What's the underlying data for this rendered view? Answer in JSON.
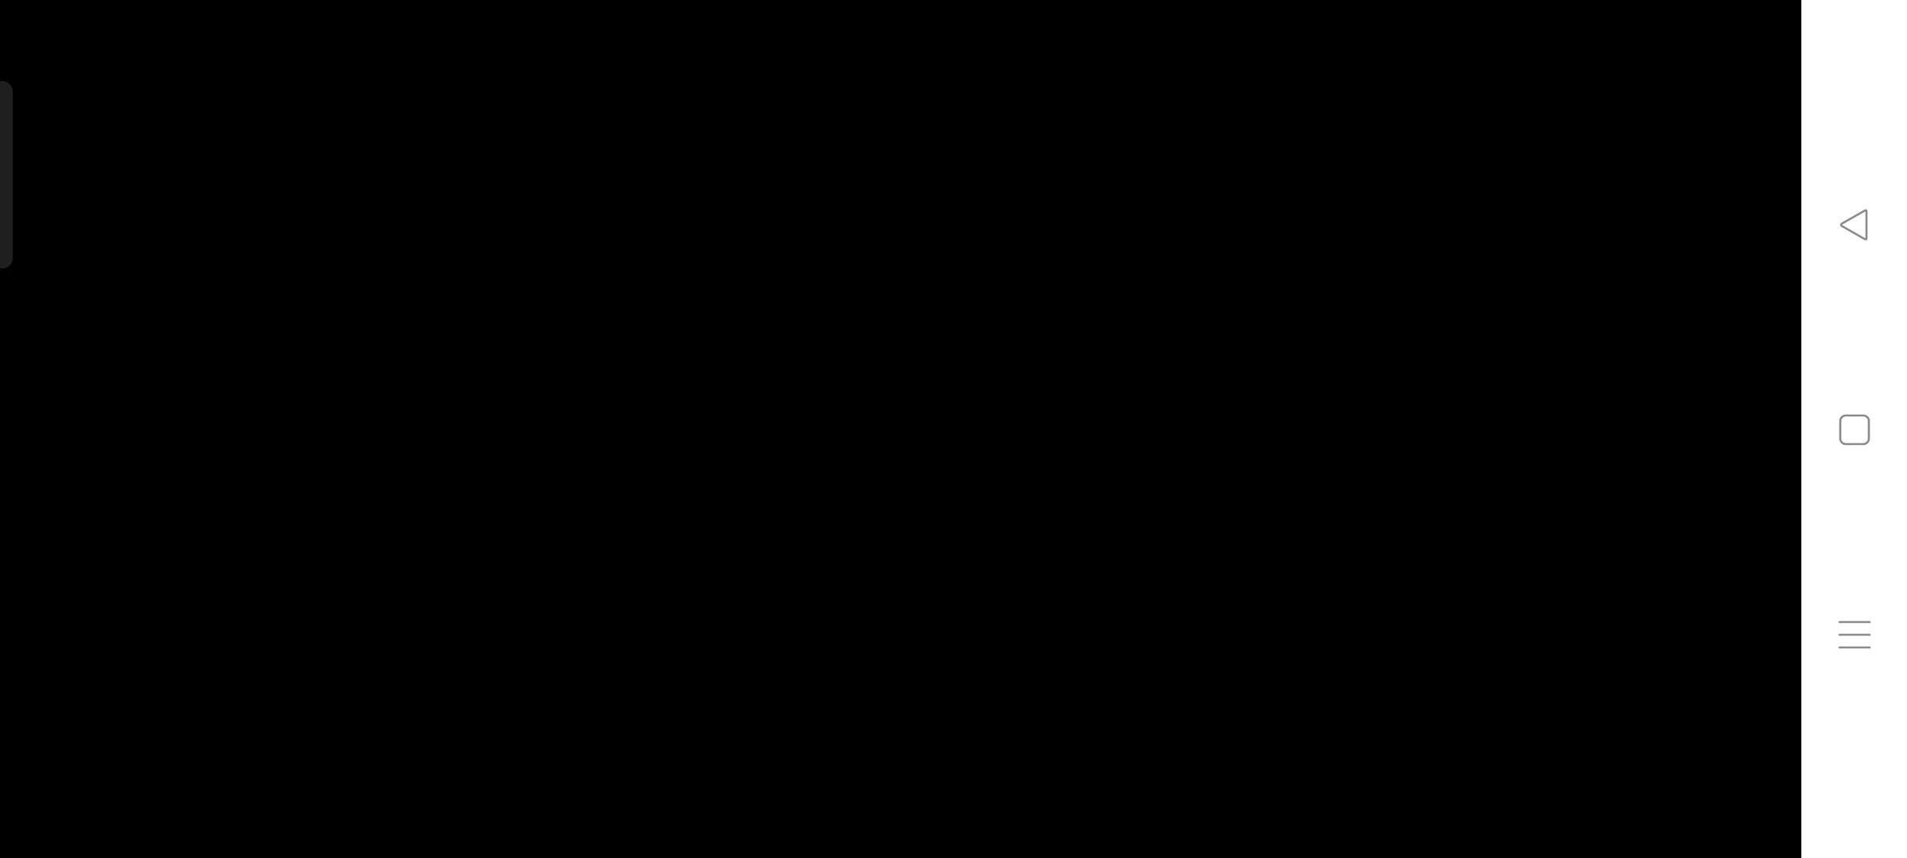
{
  "colors": {
    "app_background": "#000000",
    "nav_bar_background": "#ffffff",
    "nav_icon_stroke": "#8a8a8a",
    "edge_handle": "#1f1f1f"
  },
  "navigation_bar": {
    "buttons": [
      {
        "name": "back",
        "icon": "back-triangle-icon"
      },
      {
        "name": "home",
        "icon": "home-square-icon"
      },
      {
        "name": "recents",
        "icon": "recents-lines-icon"
      }
    ]
  },
  "edge_panel": {
    "icon": "edge-panel-handle"
  }
}
